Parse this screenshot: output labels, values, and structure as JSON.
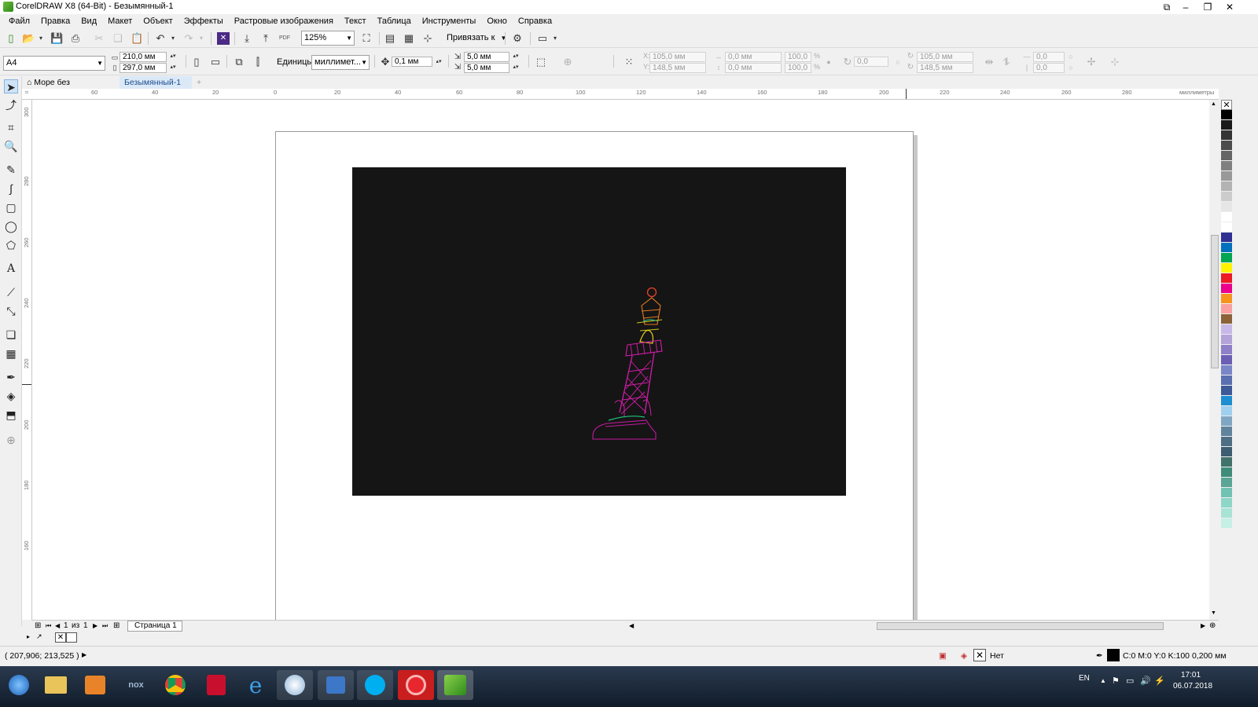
{
  "window": {
    "title": "CorelDRAW X8 (64-Bit) - Безымянный-1"
  },
  "menu": [
    "Файл",
    "Правка",
    "Вид",
    "Макет",
    "Объект",
    "Эффекты",
    "Растровые изображения",
    "Текст",
    "Таблица",
    "Инструменты",
    "Окно",
    "Справка"
  ],
  "toolbar": {
    "zoom": "125%",
    "snap_label": "Привязать к",
    "pdf_label": "PDF"
  },
  "propbar": {
    "page_size": "A4",
    "width": "210,0 мм",
    "height": "297,0 мм",
    "units_label": "Единицы:",
    "units_value": "миллимет...",
    "nudge": "0,1 мм",
    "dup_x": "5,0 мм",
    "dup_y": "5,0 мм",
    "pos_x": "105,0 мм",
    "pos_y": "148,5 мм",
    "size_x": "0,0 мм",
    "size_y": "0,0 мм",
    "scale_x": "100,0",
    "scale_y": "100,0",
    "scale_unit": "%",
    "angle": "0,0",
    "center_x": "105,0 мм",
    "center_y": "148,5 мм",
    "extra_x": "0,0",
    "extra_y": "0,0"
  },
  "tabs": [
    {
      "label": "Море без солнца.cdr",
      "active": false
    },
    {
      "label": "Безымянный-1",
      "active": true
    }
  ],
  "ruler": {
    "h_labels": [
      "60",
      "40",
      "20",
      "0",
      "20",
      "40",
      "60",
      "80",
      "100",
      "120",
      "140",
      "160",
      "180",
      "200",
      "220",
      "240",
      "260",
      "280"
    ],
    "h_unit": "миллиметры",
    "v_labels": [
      "300",
      "280",
      "260",
      "240",
      "220",
      "200",
      "180",
      "160"
    ]
  },
  "pagenav": {
    "current": "1",
    "of": "из",
    "total": "1",
    "page_tab": "Страница 1"
  },
  "status": {
    "cursor": "( 207,906; 213,525 )",
    "fill_label": "Нет",
    "outline": "C:0 M:0 Y:0 K:100  0,200 мм"
  },
  "palette_colors": [
    "#000000",
    "#1a1a1a",
    "#333333",
    "#4d4d4d",
    "#666666",
    "#808080",
    "#999999",
    "#b3b3b3",
    "#cccccc",
    "#e6e6e6",
    "#ffffff",
    "#ffffff",
    "#2e3192",
    "#0071bc",
    "#00a651",
    "#fff200",
    "#ed1c24",
    "#ec008c",
    "#f7941d",
    "#f9a0a0",
    "#8c6239",
    "#c7b8e8",
    "#b3a3d9",
    "#8f7fc7",
    "#6a5fb5",
    "#7a86c7",
    "#5b6fb0",
    "#3d5a98",
    "#1d8fd1",
    "#9fd0ef",
    "#7fa7c4",
    "#60839e",
    "#4e6e85",
    "#3e5d70",
    "#42736b",
    "#3f8c7b",
    "#5aa596",
    "#71c2b2",
    "#8ed6c7",
    "#a8e3d5",
    "#c6efe6"
  ],
  "taskbar": {
    "lang": "EN",
    "time": "17:01",
    "date": "06.07.2018"
  }
}
